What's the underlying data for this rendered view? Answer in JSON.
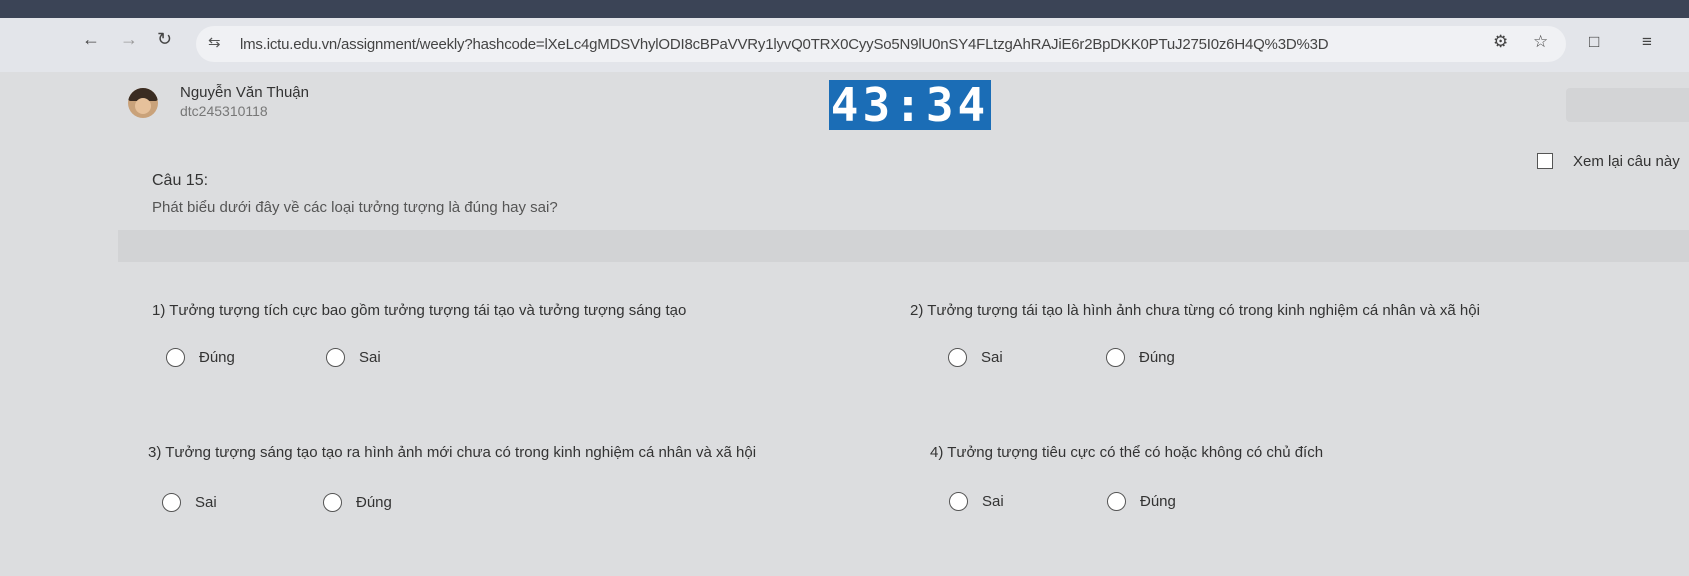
{
  "browser": {
    "url": "lms.ictu.edu.vn/assignment/weekly?hashcode=lXeLc4gMDSVhylODI8cBPaVVRy1lyvQ0TRX0CyySo5N9lU0nSY4FLtzgAhRAJiE6r2BpDKK0PTuJ275I0z6H4Q%3D%3D",
    "icons": [
      "back-arrow-icon",
      "forward-arrow-icon",
      "reload-icon",
      "site-settings-icon",
      "key-icon",
      "star-icon",
      "extensions-icon",
      "menu-icon"
    ]
  },
  "user": {
    "name": "Nguyễn Văn Thuận",
    "id": "dtc245310118"
  },
  "timer": {
    "value": "43:34",
    "color": "#1b6db6"
  },
  "review": {
    "label": "Xem lại câu này"
  },
  "question": {
    "title": "Câu 15:",
    "text": "Phát biểu dưới đây về các loại tưởng tượng là đúng hay sai?",
    "statements": [
      {
        "text": "1) Tưởng tượng tích cực bao gồm tưởng tượng tái tạo và tưởng tượng sáng tạo",
        "options": [
          "Đúng",
          "Sai"
        ]
      },
      {
        "text": "2) Tưởng tượng tái tạo là hình ảnh chưa từng có trong kinh nghiệm cá nhân và xã hội",
        "options": [
          "Sai",
          "Đúng"
        ]
      },
      {
        "text": "3) Tưởng tượng sáng tạo tạo ra hình ảnh mới chưa có trong kinh nghiệm cá nhân và xã hội",
        "options": [
          "Sai",
          "Đúng"
        ]
      },
      {
        "text": "4) Tưởng tượng tiêu cực có thể có hoặc không có chủ đích",
        "options": [
          "Sai",
          "Đúng"
        ]
      }
    ]
  }
}
